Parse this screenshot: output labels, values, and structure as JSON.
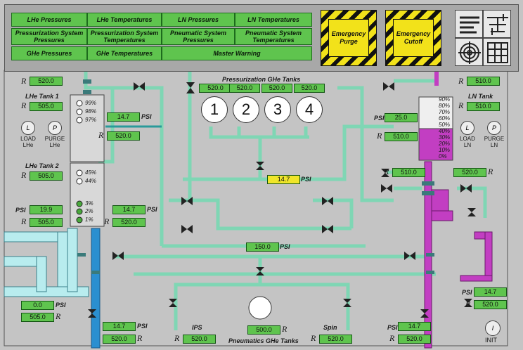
{
  "nav": [
    "LHe Pressures",
    "LHe Temperatures",
    "LN Pressures",
    "LN Temperatures",
    "Pressurization System Pressures",
    "Pressurization System Temperatures",
    "Pneumatic System Pressures",
    "Pneumatic System Temperatures",
    "GHe Pressures",
    "GHe Temperatures",
    "Master Warning"
  ],
  "emergency": {
    "purge": "Emergency Purge",
    "cutoff": "Emergency Cutoff"
  },
  "icons": [
    "list-icon",
    "schematic-icon",
    "target-icon",
    "data-grid-icon"
  ],
  "labels": {
    "pressurization_tanks": "Pressurization GHe Tanks",
    "pneumatics_tanks": "Pneumatics GHe Tanks",
    "lhe_tank1": "LHe Tank 1",
    "lhe_tank2": "LHe Tank 2",
    "ln_tank": "LN Tank",
    "psi": "PSI",
    "R": "R",
    "ips": "IPS",
    "spin": "Spin",
    "init": "INIT",
    "load": "LOAD",
    "purge": "PURGE",
    "lhe": "LHe",
    "ln": "LN"
  },
  "tank_numbers": [
    "1",
    "2",
    "3",
    "4"
  ],
  "lhe_tank1_levels": [
    "99%",
    "98%",
    "97%"
  ],
  "lhe_tank2_levels": [
    "45%",
    "44%",
    "3%",
    "2%",
    "1%"
  ],
  "ln_levels": [
    "90%",
    "80%",
    "70%",
    "60%",
    "50%",
    "40%",
    "30%",
    "20%",
    "10%",
    "0%"
  ],
  "readouts": {
    "top_left_r": "520.0",
    "lhe1_r": "505.0",
    "lhe1_psi": "14.7",
    "lhe1_r2": "520.0",
    "lhe2_r": "505.0",
    "lhe2_psi": "19.9",
    "lhe2_r2": "505.0",
    "lhe2_psi_right": "14.7",
    "lhe2_r_right": "520.0",
    "ghe_1": "520.0",
    "ghe_2": "520.0",
    "ghe_3": "520.0",
    "ghe_4": "520.0",
    "center_psi": "14.7",
    "manifold_psi": "150.0",
    "ln_r_top": "510.0",
    "ln_r": "510.0",
    "ln_psi": "25.0",
    "ln_r_mid": "510.0",
    "ln_r_low": "510.0",
    "ln_r_right": "520.0",
    "right_psi": "14.7",
    "right_r": "520.0",
    "left_psi": "0.0",
    "left_r": "505.0",
    "bottom_left_psi": "14.7",
    "bottom_left_r": "520.0",
    "ips_r": "520.0",
    "pneu_r": "500.0",
    "spin_r": "520.0",
    "bottom_right_psi": "14.7",
    "bottom_right_r": "520.0"
  }
}
